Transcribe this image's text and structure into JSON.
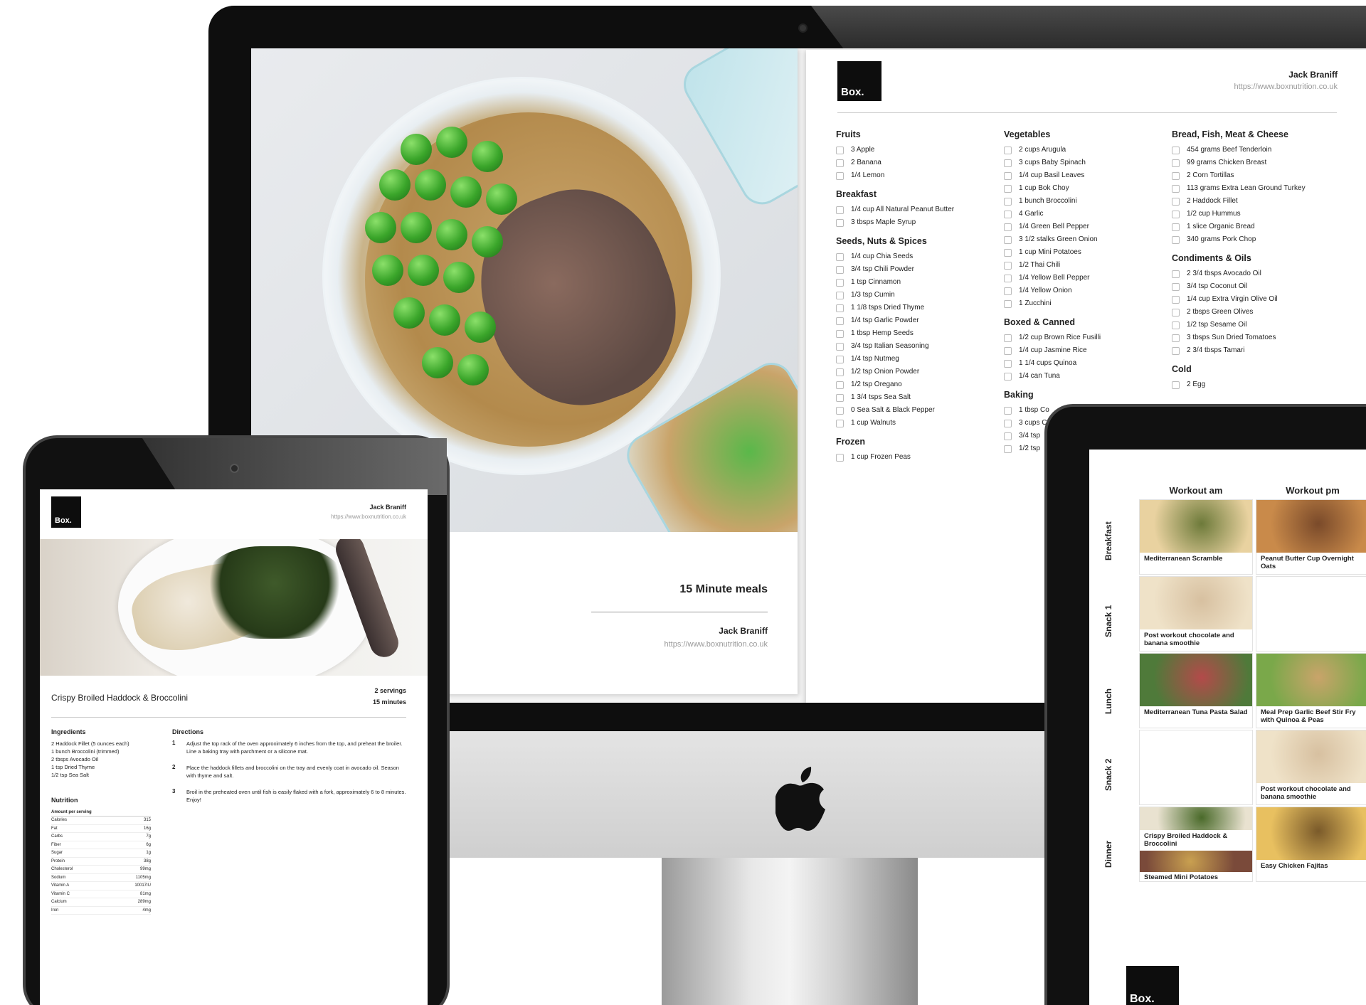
{
  "brand": {
    "logo": "Box.",
    "author": "Jack Braniff",
    "url": "https://www.boxnutrition.co.uk"
  },
  "colors": {
    "accent": "#0d0d0d",
    "pea": "#3aa52a"
  },
  "cover": {
    "title": "15 Minute meals",
    "author": "Jack Braniff",
    "url": "https://www.boxnutrition.co.uk"
  },
  "shopping": {
    "columns": [
      [
        {
          "title": "Fruits",
          "items": [
            "3 Apple",
            "2 Banana",
            "1/4 Lemon"
          ]
        },
        {
          "title": "Breakfast",
          "items": [
            "1/4 cup All Natural Peanut Butter",
            "3 tbsps Maple Syrup"
          ]
        },
        {
          "title": "Seeds, Nuts & Spices",
          "items": [
            "1/4 cup Chia Seeds",
            "3/4 tsp Chili Powder",
            "1 tsp Cinnamon",
            "1/3 tsp Cumin",
            "1 1/8 tsps Dried Thyme",
            "1/4 tsp Garlic Powder",
            "1 tbsp Hemp Seeds",
            "3/4 tsp Italian Seasoning",
            "1/4 tsp Nutmeg",
            "1/2 tsp Onion Powder",
            "1/2 tsp Oregano",
            "1 3/4 tsps Sea Salt",
            "0 Sea Salt & Black Pepper",
            "1 cup Walnuts"
          ]
        },
        {
          "title": "Frozen",
          "items": [
            "1 cup Frozen Peas"
          ]
        }
      ],
      [
        {
          "title": "Vegetables",
          "items": [
            "2 cups Arugula",
            "3 cups Baby Spinach",
            "1/4 cup Basil Leaves",
            "1 cup Bok Choy",
            "1 bunch Broccolini",
            "4 Garlic",
            "1/4 Green Bell Pepper",
            "3 1/2 stalks Green Onion",
            "1 cup Mini Potatoes",
            "1/2 Thai Chili",
            "1/4 Yellow Bell Pepper",
            "1/4 Yellow Onion",
            "1 Zucchini"
          ]
        },
        {
          "title": "Boxed & Canned",
          "items": [
            "1/2 cup Brown Rice Fusilli",
            "1/4 cup Jasmine Rice",
            "1 1/4 cups Quinoa",
            "1/4 can Tuna"
          ]
        },
        {
          "title": "Baking",
          "items": [
            "1 tbsp Co",
            "3 cups C",
            "3/4 tsp",
            "1/2 tsp"
          ]
        }
      ],
      [
        {
          "title": "Bread, Fish, Meat & Cheese",
          "items": [
            "454 grams Beef Tenderloin",
            "99 grams Chicken Breast",
            "2 Corn Tortillas",
            "113 grams Extra Lean Ground Turkey",
            "2 Haddock Fillet",
            "1/2 cup Hummus",
            "1 slice Organic Bread",
            "340 grams Pork Chop"
          ]
        },
        {
          "title": "Condiments & Oils",
          "items": [
            "2 3/4 tbsps Avocado Oil",
            "3/4 tsp Coconut Oil",
            "1/4 cup Extra Virgin Olive Oil",
            "2 tbsps Green Olives",
            "1/2 tsp Sesame Oil",
            "3 tbsps Sun Dried Tomatoes",
            "2 3/4 tbsps Tamari"
          ]
        },
        {
          "title": "Cold",
          "items": [
            "2 Egg"
          ]
        }
      ]
    ]
  },
  "recipe": {
    "title": "Crispy Broiled Haddock & Broccolini",
    "servings": "2 servings",
    "time": "15 minutes",
    "ingredients_label": "Ingredients",
    "ingredients": [
      "2 Haddock Fillet (5 ounces each)",
      "1 bunch Broccolini (trimmed)",
      "2 tbsps Avocado Oil",
      "1 tsp Dried Thyme",
      "1/2 tsp Sea Salt"
    ],
    "nutrition_label": "Nutrition",
    "nutrition_header": "Amount per serving",
    "nutrition": [
      [
        "Calories",
        "315"
      ],
      [
        "Fat",
        "16g"
      ],
      [
        "Carbs",
        "7g"
      ],
      [
        "Fiber",
        "6g"
      ],
      [
        "Sugar",
        "1g"
      ],
      [
        "Protein",
        "38g"
      ],
      [
        "Cholesterol",
        "99mg"
      ],
      [
        "Sodium",
        "1105mg"
      ],
      [
        "Vitamin A",
        "10017IU"
      ],
      [
        "Vitamin C",
        "81mg"
      ],
      [
        "Calcium",
        "289mg"
      ],
      [
        "Iron",
        "4mg"
      ]
    ],
    "directions_label": "Directions",
    "directions": [
      {
        "n": "1",
        "text": "Adjust the top rack of the oven approximately 6 inches from the top, and preheat the broiler. Line a baking tray with parchment or a silicone mat."
      },
      {
        "n": "2",
        "text": "Place the haddock fillets and broccolini on the tray and evenly coat in avocado oil. Season with thyme and salt."
      },
      {
        "n": "3",
        "text": "Broil in the preheated oven until fish is easily flaked with a fork, approximately 6 to 8 minutes. Enjoy!"
      }
    ]
  },
  "planner": {
    "columns": [
      "Workout am",
      "Workout pm"
    ],
    "rows": [
      "Breakfast",
      "Snack 1",
      "Lunch",
      "Snack 2",
      "Dinner"
    ],
    "cells": [
      [
        "Mediterranean Scramble",
        "Peanut Butter Cup Overnight Oats"
      ],
      [
        "Post workout chocolate and banana smoothie",
        ""
      ],
      [
        "Mediterranean Tuna Pasta Salad",
        "Meal Prep Garlic Beef Stir Fry with Quinoa & Peas"
      ],
      [
        "",
        "Post workout chocolate and banana smoothie"
      ],
      [
        "Crispy Broiled Haddock & Broccolini",
        "Easy Chicken Fajitas"
      ]
    ],
    "dinner_extra": "Steamed Mini Potatoes"
  }
}
